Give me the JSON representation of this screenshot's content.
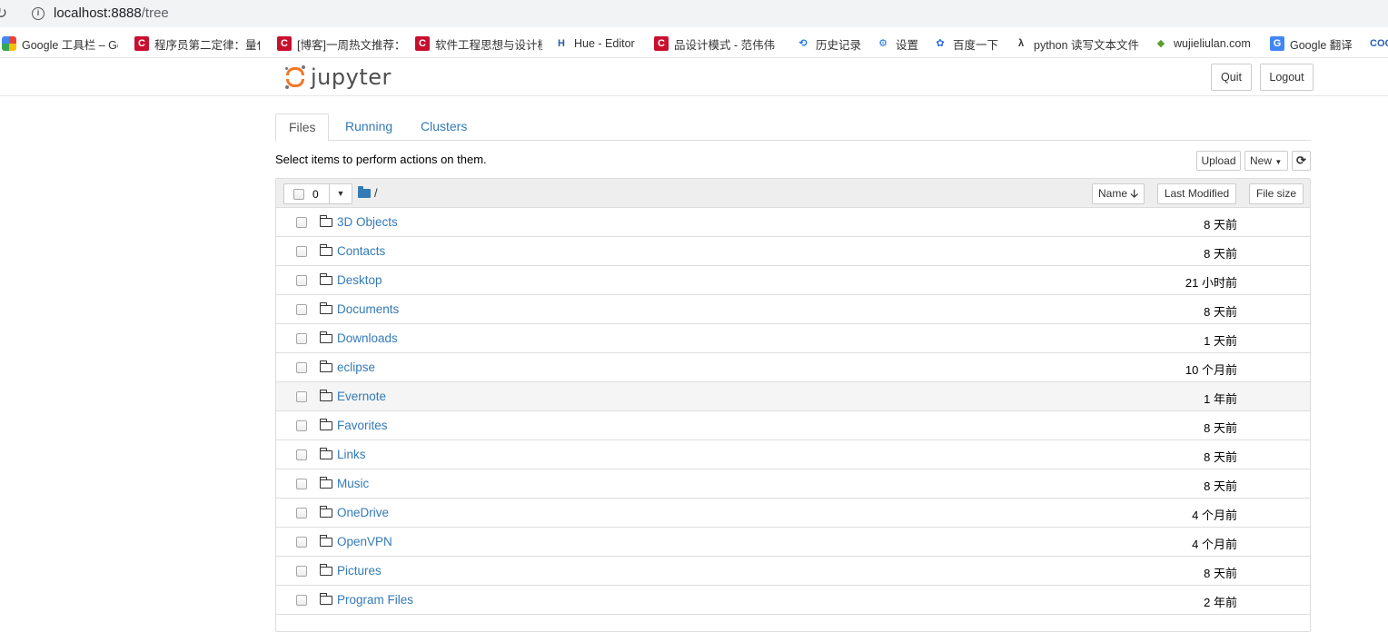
{
  "browser": {
    "url_host": "localhost:8888",
    "url_path": "/tree",
    "bookmarks": [
      {
        "label": "Google 工具栏 – Go",
        "icon": "google-toolbar-icon",
        "glyph": ""
      },
      {
        "label": "程序员第二定律：量化",
        "icon": "csdn-icon",
        "glyph": "C"
      },
      {
        "label": "[博客]一周热文推荐：",
        "icon": "csdn-icon",
        "glyph": "C"
      },
      {
        "label": "软件工程思想与设计模",
        "icon": "csdn-icon",
        "glyph": "C"
      },
      {
        "label": "Hue - Editor",
        "icon": "hue-icon",
        "glyph": "H"
      },
      {
        "label": "品设计模式 - 范伟伟",
        "icon": "csdn-icon",
        "glyph": "C"
      },
      {
        "label": "历史记录",
        "icon": "history-icon",
        "glyph": "⟲"
      },
      {
        "label": "设置",
        "icon": "gear-icon",
        "glyph": "⚙"
      },
      {
        "label": "百度一下",
        "icon": "baidu-icon",
        "glyph": "✿"
      },
      {
        "label": "python 读写文本文件",
        "icon": "python-icon",
        "glyph": "λ"
      },
      {
        "label": "wujieliulan.com",
        "icon": "wujie-icon",
        "glyph": "◆"
      },
      {
        "label": "Google 翻译",
        "icon": "google-translate-icon",
        "glyph": "G"
      },
      {
        "label": "",
        "icon": "coolshell-icon",
        "glyph": "COOL SHELL"
      }
    ]
  },
  "header": {
    "logo_text": "jupyter",
    "quit_label": "Quit",
    "logout_label": "Logout"
  },
  "tabs": [
    {
      "label": "Files",
      "active": true
    },
    {
      "label": "Running",
      "active": false
    },
    {
      "label": "Clusters",
      "active": false
    }
  ],
  "toolbar": {
    "hint": "Select items to perform actions on them.",
    "upload_label": "Upload",
    "new_label": "New",
    "refresh_icon": "refresh-icon"
  },
  "list_header": {
    "selected_count": "0",
    "path": "/",
    "name_sort_label": "Name",
    "last_modified_label": "Last Modified",
    "file_size_label": "File size"
  },
  "files": [
    {
      "name": "3D Objects",
      "modified": "8 天前"
    },
    {
      "name": "Contacts",
      "modified": "8 天前"
    },
    {
      "name": "Desktop",
      "modified": "21 小时前"
    },
    {
      "name": "Documents",
      "modified": "8 天前"
    },
    {
      "name": "Downloads",
      "modified": "1 天前"
    },
    {
      "name": "eclipse",
      "modified": "10 个月前"
    },
    {
      "name": "Evernote",
      "modified": "1 年前"
    },
    {
      "name": "Favorites",
      "modified": "8 天前"
    },
    {
      "name": "Links",
      "modified": "8 天前"
    },
    {
      "name": "Music",
      "modified": "8 天前"
    },
    {
      "name": "OneDrive",
      "modified": "4 个月前"
    },
    {
      "name": "OpenVPN",
      "modified": "4 个月前"
    },
    {
      "name": "Pictures",
      "modified": "8 天前"
    },
    {
      "name": "Program Files",
      "modified": "2 年前"
    }
  ],
  "colors": {
    "link": "#337ab7",
    "jupyter_orange": "#f37726"
  }
}
